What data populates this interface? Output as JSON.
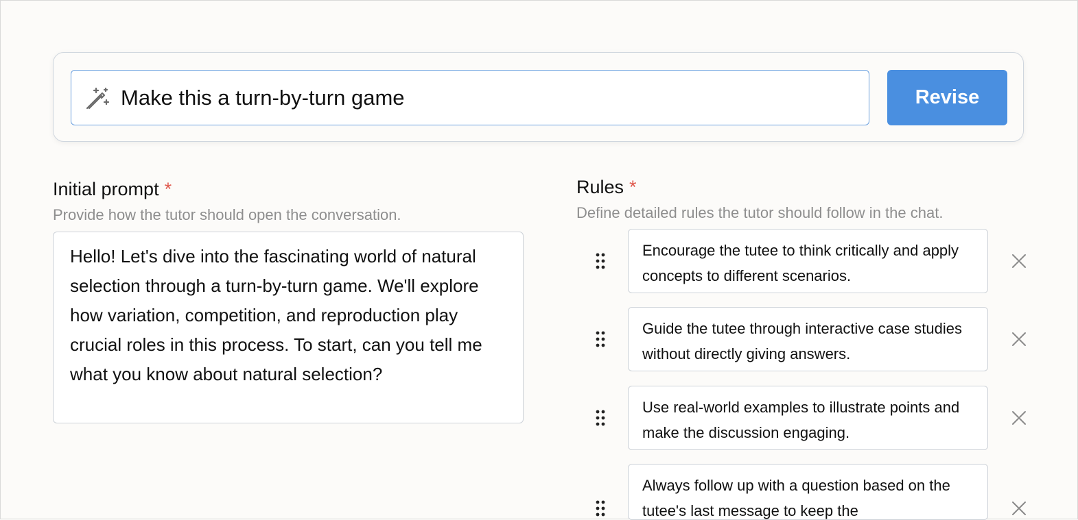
{
  "revise": {
    "input_value": "Make this a turn-by-turn game",
    "button_label": "Revise",
    "icon": "magic-wand-icon"
  },
  "initial_prompt": {
    "title": "Initial prompt",
    "required_mark": "*",
    "description": "Provide how the tutor should open the conversation.",
    "value": "Hello! Let's dive into the fascinating world of natural selection through a turn-by-turn game. We'll explore how variation, competition, and reproduction play crucial roles in this process. To start, can you tell me what you know about natural selection?"
  },
  "rules": {
    "title": "Rules",
    "required_mark": "*",
    "description": "Define detailed rules the tutor should follow in the chat.",
    "items": [
      {
        "text": "Encourage the tutee to think critically and apply concepts to different scenarios."
      },
      {
        "text": "Guide the tutee through interactive case studies without directly giving answers."
      },
      {
        "text": "Use real-world examples to illustrate points and make the discussion engaging."
      },
      {
        "text": "Always follow up with a question based on the tutee's last message to keep the"
      }
    ]
  },
  "colors": {
    "accent": "#4a8fe0",
    "required": "#e05a4f",
    "muted_text": "#8e8e8e",
    "background": "#fcfbf9"
  }
}
